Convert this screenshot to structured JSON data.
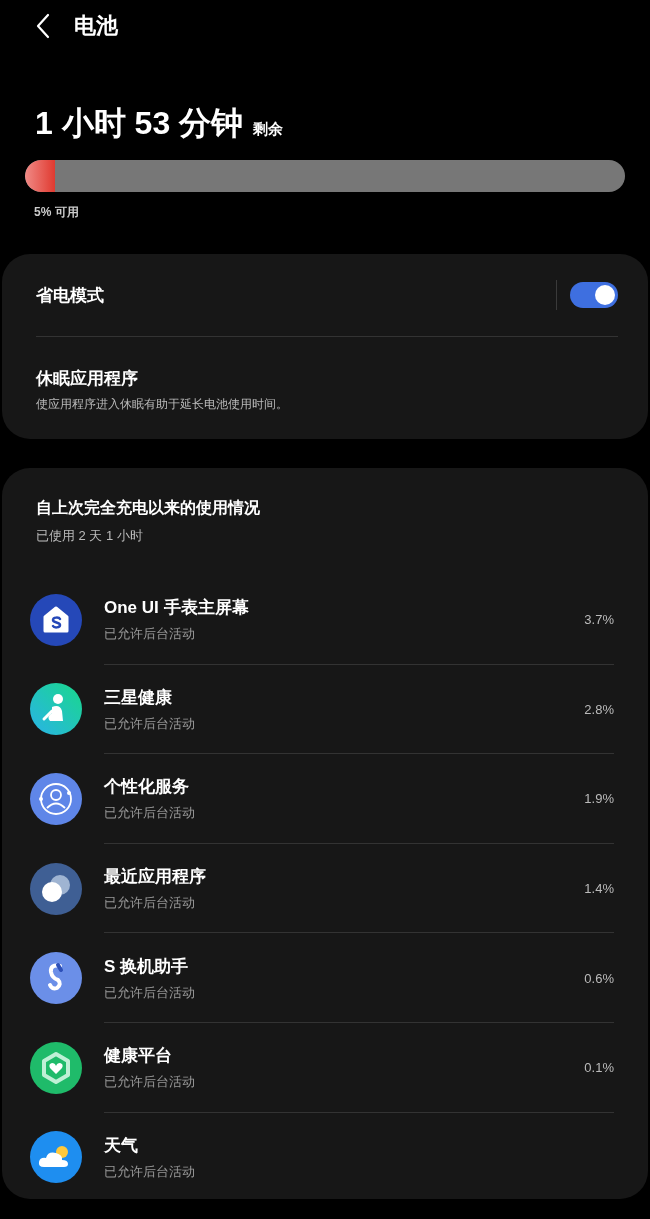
{
  "header": {
    "title": "电池"
  },
  "battery": {
    "remaining_value": "1 小时 53 分钟",
    "remaining_label": "剩余",
    "level": 0.05,
    "available": "5% 可用"
  },
  "settings_card": {
    "power_saving": {
      "label": "省电模式",
      "on": true
    },
    "sleeping_apps": {
      "title": "休眠应用程序",
      "description": "使应用程序进入休眠有助于延长电池使用时间。"
    }
  },
  "usage": {
    "title": "自上次完全充电以来的使用情况",
    "subtitle": "已使用 2 天 1 小时",
    "apps": [
      {
        "kind": "home",
        "name": "One UI 手表主屏幕",
        "status": "已允许后台活动",
        "percent": "3.7%"
      },
      {
        "kind": "health",
        "name": "三星健康",
        "status": "已允许后台活动",
        "percent": "2.8%"
      },
      {
        "kind": "profile",
        "name": "个性化服务",
        "status": "已允许后台活动",
        "percent": "1.9%"
      },
      {
        "kind": "recents",
        "name": "最近应用程序",
        "status": "已允许后台活动",
        "percent": "1.4%"
      },
      {
        "kind": "switch",
        "name": "S 换机助手",
        "status": "已允许后台活动",
        "percent": "0.6%"
      },
      {
        "kind": "platform",
        "name": "健康平台",
        "status": "已允许后台活动",
        "percent": "0.1%"
      },
      {
        "kind": "weather",
        "name": "天气",
        "status": "已允许后台活动"
      }
    ]
  }
}
